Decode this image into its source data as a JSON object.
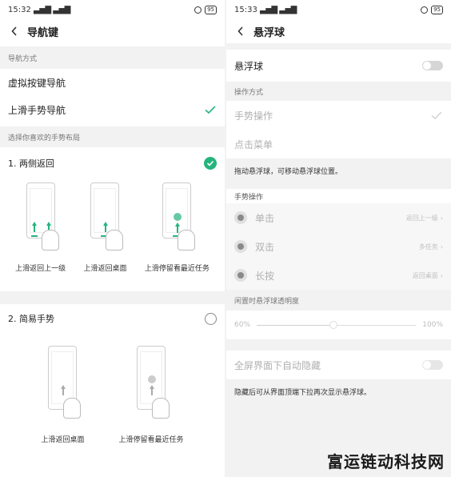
{
  "left": {
    "status": {
      "time": "15:32",
      "signal": "▃▅▇ ▃▅▇",
      "battery": "95"
    },
    "title": "导航键",
    "nav_mode_label": "导航方式",
    "nav_options": [
      {
        "label": "虚拟按键导航",
        "selected": false
      },
      {
        "label": "上滑手势导航",
        "selected": true
      }
    ],
    "layout_label": "选择你喜欢的手势布局",
    "layouts": [
      {
        "label": "1. 两侧返回",
        "selected": true,
        "captions": [
          "上滑返回上一级",
          "上滑返回桌面",
          "上滑停留看最近任务"
        ]
      },
      {
        "label": "2. 简易手势",
        "selected": false,
        "captions": [
          "上滑返回桌面",
          "上滑停留看最近任务"
        ]
      }
    ]
  },
  "right": {
    "status": {
      "time": "15:33",
      "signal": "▃▅▇ ▃▅▇",
      "battery": "95"
    },
    "title": "悬浮球",
    "float_ball_label": "悬浮球",
    "op_mode_label": "操作方式",
    "op_modes": [
      "手势操作",
      "点击菜单"
    ],
    "drag_hint": "拖动悬浮球，可移动悬浮球位置。",
    "gesture_label": "手势操作",
    "gestures": [
      {
        "label": "单击",
        "value": "返回上一级"
      },
      {
        "label": "双击",
        "value": "多任务"
      },
      {
        "label": "长按",
        "value": "返回桌面"
      }
    ],
    "opacity_label": "闲置时悬浮球透明度",
    "opacity_min": "60%",
    "opacity_max": "100%",
    "opacity_value": 0.48,
    "auto_hide_label": "全屏界面下自动隐藏",
    "auto_hide_hint": "隐藏后可从界面顶端下拉再次显示悬浮球。"
  },
  "watermark": "富运链动科技网",
  "colors": {
    "accent": "#24b47e",
    "section_bg": "#f2f2f2",
    "disabled_text": "#b0b0b0"
  },
  "icons": [
    "back-chevron-icon",
    "checkmark-icon",
    "check-circle-icon",
    "toggle-switch",
    "gesture-dot-icon",
    "chevron-right-icon"
  ]
}
